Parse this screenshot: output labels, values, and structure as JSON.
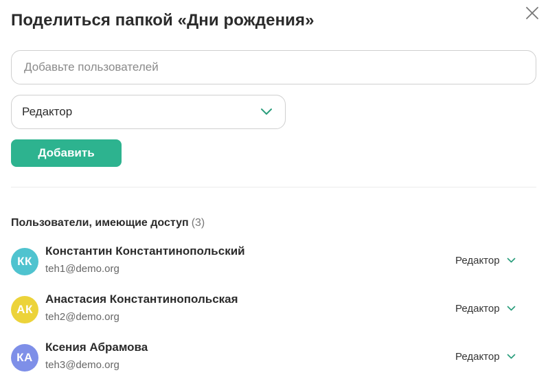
{
  "dialog": {
    "title": "Поделиться папкой «Дни рождения»"
  },
  "add_form": {
    "placeholder": "Добавьте пользователей",
    "role_value": "Редактор",
    "add_label": "Добавить"
  },
  "access": {
    "title": "Пользователи, имеющие доступ",
    "count": "(3)",
    "users": [
      {
        "initials": "КК",
        "name": "Константин Константинопольский",
        "email": "teh1@demo.org",
        "role": "Редактор",
        "avatar_color": "#4fc3cf"
      },
      {
        "initials": "АК",
        "name": "Анастасия Константинопольская",
        "email": "teh2@demo.org",
        "role": "Редактор",
        "avatar_color": "#ecd33a"
      },
      {
        "initials": "КА",
        "name": "Ксения Абрамова",
        "email": "teh3@demo.org",
        "role": "Редактор",
        "avatar_color": "#7e8fe8"
      }
    ]
  },
  "colors": {
    "accent": "#2db38f",
    "chevron": "#2a9d7c"
  },
  "icons": {
    "close": "close-icon",
    "chevron": "chevron-down-icon"
  }
}
